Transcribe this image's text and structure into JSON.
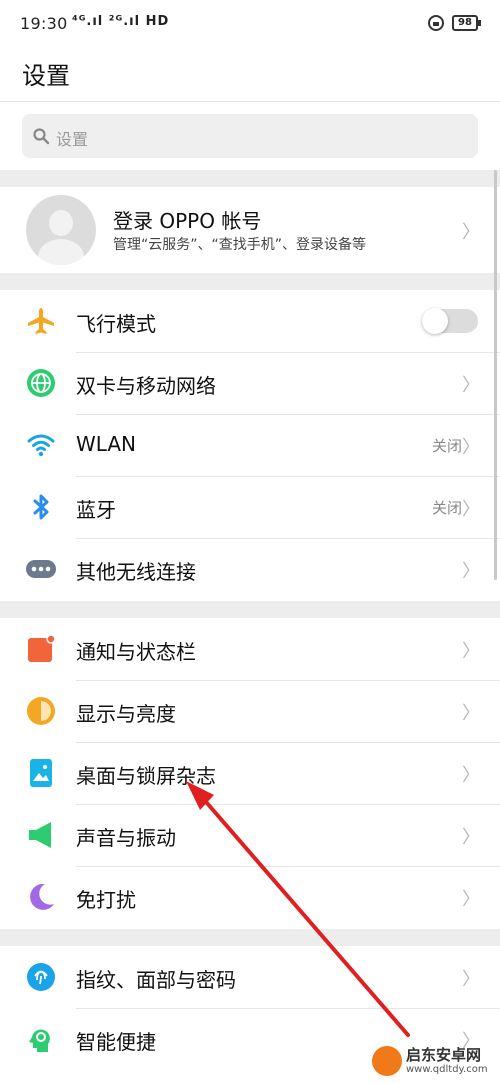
{
  "status_bar": {
    "time": "19:30",
    "signals": "⁴ᴳ.ıl ²ᴳ.ıl HD",
    "battery": "98"
  },
  "header": {
    "title": "设置"
  },
  "search": {
    "placeholder": "设置"
  },
  "account": {
    "name": "登录 OPPO 帐号",
    "subtitle": "管理“云服务”、“查找手机”、登录设备等"
  },
  "section1": [
    {
      "label": "飞行模式",
      "icon": "airplane-icon",
      "toggle": false
    },
    {
      "label": "双卡与移动网络",
      "icon": "globe-icon"
    },
    {
      "label": "WLAN",
      "icon": "wifi-icon",
      "status": "关闭"
    },
    {
      "label": "蓝牙",
      "icon": "bluetooth-icon",
      "status": "关闭"
    },
    {
      "label": "其他无线连接",
      "icon": "more-connections-icon"
    }
  ],
  "section2": [
    {
      "label": "通知与状态栏",
      "icon": "notification-icon"
    },
    {
      "label": "显示与亮度",
      "icon": "brightness-icon"
    },
    {
      "label": "桌面与锁屏杂志",
      "icon": "wallpaper-icon"
    },
    {
      "label": "声音与振动",
      "icon": "speaker-icon"
    },
    {
      "label": "免打扰",
      "icon": "moon-icon"
    }
  ],
  "section3": [
    {
      "label": "指纹、面部与密码",
      "icon": "fingerprint-icon"
    },
    {
      "label": "智能便捷",
      "icon": "smart-assist-icon"
    }
  ],
  "chevron": "〉",
  "watermark": {
    "line1": "启东安卓网",
    "line2": "www.qdltdy.com"
  },
  "colors": {
    "accent_orange": "#f5a623",
    "green": "#2ecc71",
    "wifi_blue": "#1aa3e8",
    "bluetooth_blue": "#2a8ef0",
    "annotation_red": "#e02020"
  }
}
